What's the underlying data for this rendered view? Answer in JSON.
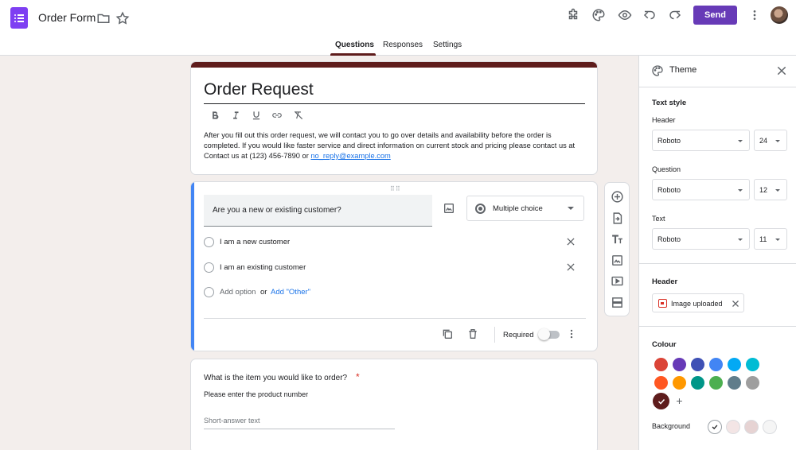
{
  "app": {
    "doc_title": "Order Form",
    "send_label": "Send"
  },
  "tabs": [
    {
      "label": "Questions",
      "active": true
    },
    {
      "label": "Responses",
      "active": false
    },
    {
      "label": "Settings",
      "active": false
    }
  ],
  "form": {
    "title": "Order Request",
    "description_text": "After you fill out this order request, we will contact you to go over details and availability before the order is completed. If you would like faster service and direct information on current stock and pricing please contact us at Contact us at (123) 456-7890 or ",
    "description_link": "no_reply@example.com"
  },
  "question1": {
    "title": "Are you a new or existing customer?",
    "type": "Multiple choice",
    "options": [
      "I am a new customer",
      "I am an existing customer"
    ],
    "add_option": "Add option",
    "or": "or",
    "add_other": "Add \"Other\"",
    "required_label": "Required",
    "required": false
  },
  "question2": {
    "title": "What is the item you would like to order?",
    "required_mark": "*",
    "help": "Please enter the product number",
    "answer_placeholder": "Short-answer text"
  },
  "theme": {
    "title": "Theme",
    "text_style_heading": "Text style",
    "header_label": "Header",
    "header_font": "Roboto",
    "header_size": "24",
    "question_label": "Question",
    "question_font": "Roboto",
    "question_size": "12",
    "text_label": "Text",
    "text_font": "Roboto",
    "text_size": "11",
    "header_section": "Header",
    "header_image": "Image uploaded",
    "colour_heading": "Colour",
    "background_label": "Background",
    "colours": [
      "#db4437",
      "#673ab7",
      "#3f51b5",
      "#4285f4",
      "#03a9f4",
      "#00bcd4",
      "#ff5722",
      "#ff9800",
      "#009688",
      "#4caf50",
      "#607d8b",
      "#9e9e9e"
    ],
    "selected_colour": "#5e1c1c",
    "backgrounds": [
      "#ffffff",
      "#f3e5e5",
      "#e6d3d3",
      "#f5f5f5"
    ]
  },
  "colors": {
    "accent": "#673ab7",
    "theme": "#5e1c1c",
    "active_question": "#4285f4"
  }
}
